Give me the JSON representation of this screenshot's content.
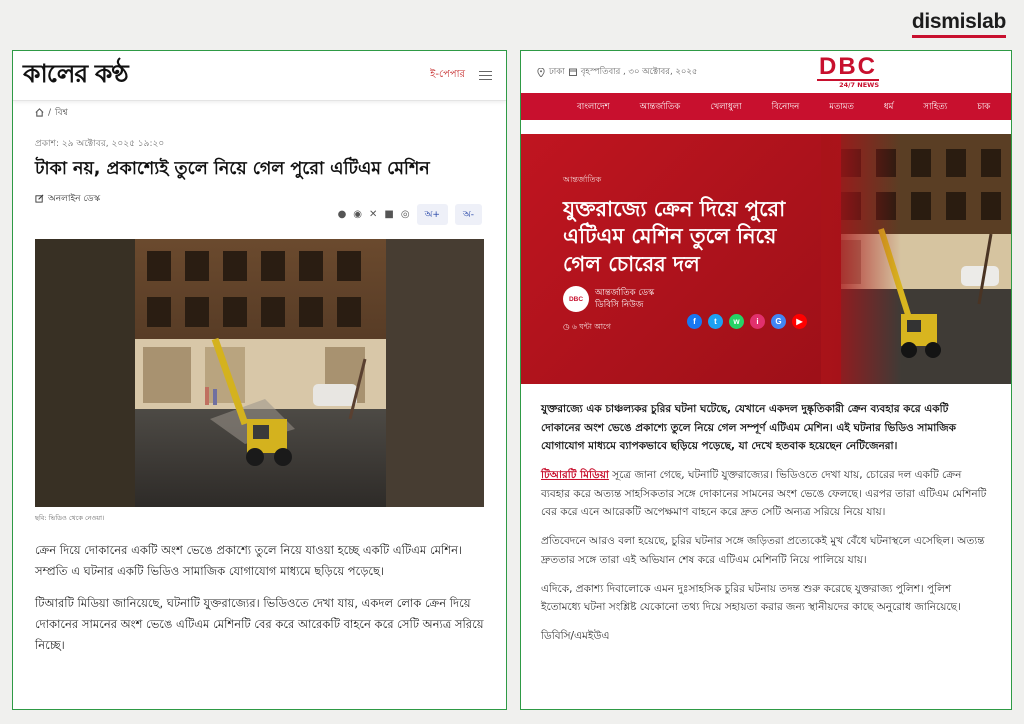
{
  "brand": {
    "name": "dismislab",
    "accent": "#c8102e"
  },
  "left": {
    "logo": "কালের কণ্ঠ",
    "epaper": "ই-পেপার",
    "breadcrumb": {
      "home_icon": "home-icon",
      "sep": "/",
      "section": "বিশ্ব"
    },
    "published": "প্রকাশ: ২৯ অক্টোবর, ২০২৫ ১৯:২০",
    "title": "টাকা নয়, প্রকাশ্যেই তুলে নিয়ে গেল পুরো এটিএম মেশিন",
    "author": "অনলাইন ডেস্ক",
    "share_icons": [
      "facebook-icon",
      "messenger-icon",
      "x-icon",
      "linkedin-icon",
      "whatsapp-icon"
    ],
    "font_increase": "অ+",
    "font_decrease": "অ-",
    "caption": "ছবি: ভিডিও থেকে নেওয়া।",
    "paragraphs": [
      "ক্রেন দিয়ে দোকানের একটি অংশ ভেঙে প্রকাশ্যে তুলে নিয়ে যাওয়া হচ্ছে একটি এটিএম মেশিন। সম্প্রতি এ ঘটনার একটি ভিডিও সামাজিক যোগাযোগ মাধ্যমে ছড়িয়ে পড়েছে।",
      "টিআরটি মিডিয়া জানিয়েছে, ঘটনাটি যুক্তরাজ্যের। ভিডিওতে দেখা যায়, একদল লোক ক্রেন দিয়ে দোকানের সামনের অংশ ভেঙে এটিএম মেশিনটি বের করে আরেকটি বাহনে করে সেটি অন্যত্র সরিয়ে নিচ্ছে।"
    ]
  },
  "right": {
    "location": "ঢাকা",
    "date": "বৃহস্পতিবার , ৩০ অক্টোবর, ২০২৫",
    "logo_main": "DBC",
    "logo_sub": "24/7 NEWS",
    "nav": [
      "বাংলাদেশ",
      "আন্তর্জাতিক",
      "খেলাধুলা",
      "বিনোদন",
      "মতামত",
      "ধর্ম",
      "সাহিত্য",
      "চাক"
    ],
    "category": "আন্তর্জাতিক",
    "title": "যুক্তরাজ্যে ক্রেন দিয়ে পুরো এটিএম মেশিন তুলে নিয়ে গেল চোরের দল",
    "avatar_text": "DBC",
    "author_desk": "আন্তর্জাতিক ডেস্ক",
    "author_org": "ডিবিসি নিউজ",
    "time": "৬ ঘন্টা আগে",
    "social_icons": [
      {
        "name": "facebook-icon",
        "glyph": "f",
        "color": "#1877f2"
      },
      {
        "name": "twitter-icon",
        "glyph": "t",
        "color": "#1da1f2"
      },
      {
        "name": "whatsapp-icon",
        "glyph": "w",
        "color": "#25d366"
      },
      {
        "name": "instagram-icon",
        "glyph": "i",
        "color": "#e1306c"
      },
      {
        "name": "google-news-icon",
        "glyph": "G",
        "color": "#4285f4"
      },
      {
        "name": "youtube-icon",
        "glyph": "▶",
        "color": "#ff0000"
      }
    ],
    "lead": "যুক্তরাজ্যে এক চাঞ্চল্যকর চুরির ঘটনা ঘটেছে, যেখানে একদল দুষ্কৃতিকারী ক্রেন ব্যবহার করে একটি দোকানের অংশ ভেঙে প্রকাশ্যে তুলে নিয়ে গেল সম্পূর্ণ এটিএম মেশিন। এই ঘটনার ভিডিও সামাজিক যোগাযোগ মাধ্যমে ব্যাপকভাবে ছড়িয়ে পড়েছে, যা দেখে হতবাক হয়েছেন নেটিজেনরা।",
    "p2_link": "টিআরটি মিডিয়া",
    "p2_rest": " সূত্রে জানা গেছে, ঘটনাটি যুক্তরাজ্যের। ভিডিওতে দেখা যায়, চোরের দল একটি ক্রেন ব্যবহার করে অত্যন্ত সাহসিকতার সঙ্গে দোকানের সামনের অংশ ভেঙে ফেলছে। এরপর তারা এটিএম মেশিনটি বের করে এনে আরেকটি অপেক্ষমাণ বাহনে করে দ্রুত সেটি অন্যত্র সরিয়ে নিয়ে যায়।",
    "p3": "প্রতিবেদনে আরও বলা হয়েছে, চুরির ঘটনার সঙ্গে জড়িতরা প্রত্যেকেই মুখ বেঁধে ঘটনাস্থলে এসেছিল। অত্যন্ত দ্রুততার সঙ্গে তারা এই অভিযান শেষ করে এটিএম মেশিনটি নিয়ে পালিয়ে যায়।",
    "p4": "এদিকে, প্রকাশ্য দিবালোকে এমন দুঃসাহসিক চুরির ঘটনায় তদন্ত শুরু করেছে যুক্তরাজ্য পুলিশ। পুলিশ ইতোমধ্যে ঘটনা সংশ্লিষ্ট যেকোনো তথ্য দিয়ে সহায়তা করার জন্য স্থানীয়দের কাছে অনুরোধ জানিয়েছে।",
    "signoff": "ডিবিসি/এমইউএ"
  }
}
